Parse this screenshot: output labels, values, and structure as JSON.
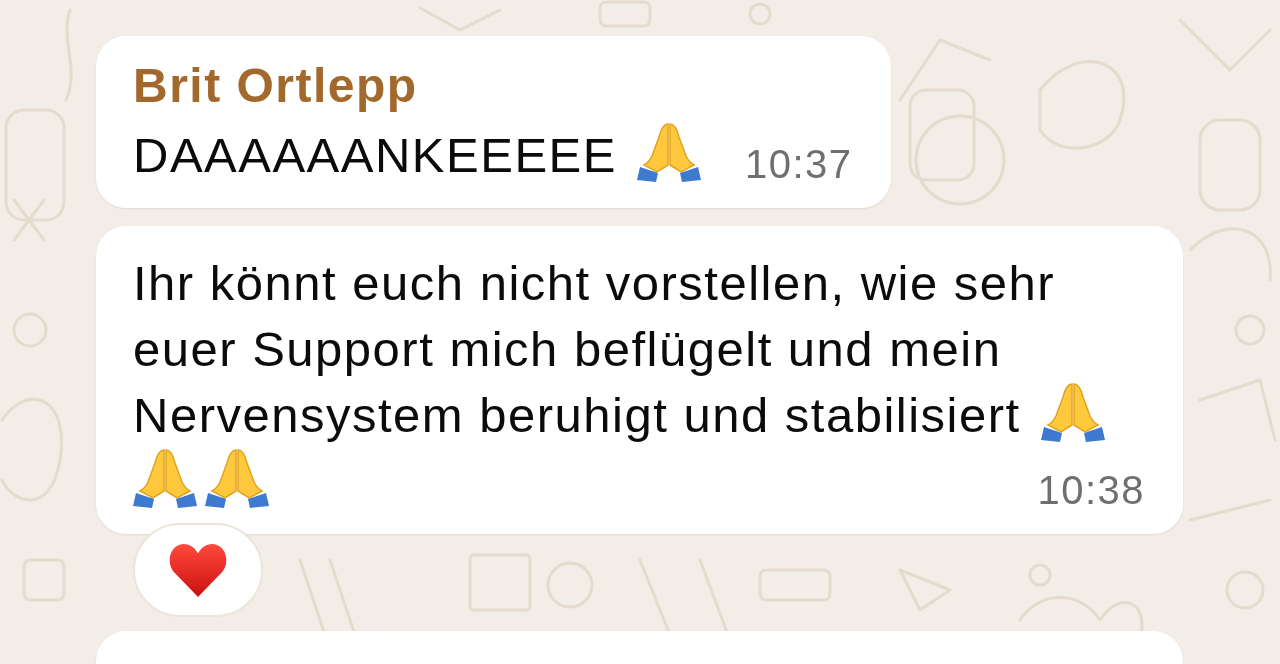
{
  "messages": [
    {
      "kind": "full",
      "sender": "Brit Ortlepp",
      "parts": [
        {
          "kind": "text",
          "text": "DAAAAAANKEEEEE"
        },
        {
          "kind": "emoji"
        }
      ],
      "time": "10:37"
    },
    {
      "kind": "full",
      "parts": [
        {
          "kind": "text",
          "text": "Ihr könnt euch nicht vorstellen, wie sehr euer Support mich beflügelt und mein Nervensystem beruhigt und stabilisiert"
        },
        {
          "kind": "emoji"
        },
        {
          "kind": "emoji"
        },
        {
          "kind": "emoji"
        }
      ],
      "time": "10:38",
      "reactions": [
        {
          "kind": "heart"
        }
      ]
    },
    {
      "kind": "clipped"
    }
  ]
}
